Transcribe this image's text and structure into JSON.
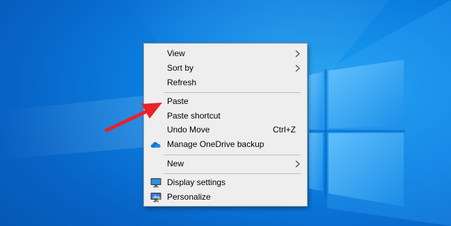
{
  "desktop": {
    "background_color": "#0a78d8",
    "logo": "windows-logo-icon"
  },
  "context_menu": {
    "items": [
      {
        "label": "View",
        "submenu": true,
        "icon": null
      },
      {
        "label": "Sort by",
        "submenu": true,
        "icon": null
      },
      {
        "label": "Refresh",
        "submenu": false,
        "icon": null
      },
      {
        "label": "Paste",
        "submenu": false,
        "icon": null
      },
      {
        "label": "Paste shortcut",
        "submenu": false,
        "icon": null
      },
      {
        "label": "Undo Move",
        "shortcut": "Ctrl+Z",
        "submenu": false,
        "icon": null
      },
      {
        "label": "Manage OneDrive backup",
        "submenu": false,
        "icon": "onedrive-cloud-icon"
      },
      {
        "label": "New",
        "submenu": true,
        "icon": null
      },
      {
        "label": "Display settings",
        "submenu": false,
        "icon": "display-settings-icon"
      },
      {
        "label": "Personalize",
        "submenu": false,
        "icon": "personalize-icon"
      }
    ]
  },
  "annotation": {
    "arrow_color": "#e8232a",
    "points_to": "Paste"
  }
}
